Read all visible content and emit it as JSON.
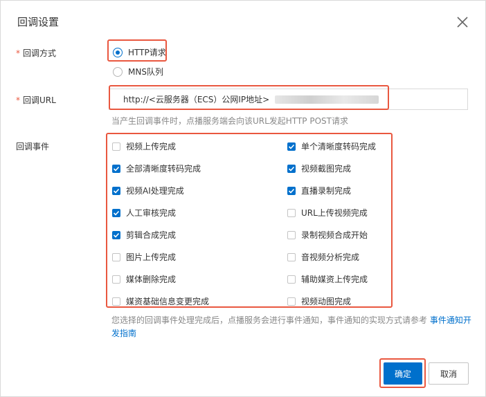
{
  "dialog": {
    "title": "回调设置"
  },
  "callback_method": {
    "label": "回调方式",
    "required_mark": "*",
    "options": [
      {
        "label": "HTTP请求",
        "selected": true
      },
      {
        "label": "MNS队列",
        "selected": false
      }
    ]
  },
  "callback_url": {
    "label": "回调URL",
    "required_mark": "*",
    "value": "http://<云服务器（ECS）公网IP地址>",
    "hint": "当产生回调事件时，点播服务端会向该URL发起HTTP POST请求"
  },
  "callback_events": {
    "label": "回调事件",
    "left": [
      {
        "label": "视频上传完成",
        "checked": false
      },
      {
        "label": "全部清晰度转码完成",
        "checked": true
      },
      {
        "label": "视频AI处理完成",
        "checked": true
      },
      {
        "label": "人工审核完成",
        "checked": true
      },
      {
        "label": "剪辑合成完成",
        "checked": true
      },
      {
        "label": "图片上传完成",
        "checked": false
      },
      {
        "label": "媒体删除完成",
        "checked": false
      },
      {
        "label": "媒资基础信息变更完成",
        "checked": false
      }
    ],
    "right": [
      {
        "label": "单个清晰度转码完成",
        "checked": true
      },
      {
        "label": "视频截图完成",
        "checked": true
      },
      {
        "label": "直播录制完成",
        "checked": true
      },
      {
        "label": "URL上传视频完成",
        "checked": false
      },
      {
        "label": "录制视频合成开始",
        "checked": false
      },
      {
        "label": "音视频分析完成",
        "checked": false
      },
      {
        "label": "辅助媒资上传完成",
        "checked": false
      },
      {
        "label": "视频动图完成",
        "checked": false
      }
    ]
  },
  "note": {
    "text": "您选择的回调事件处理完成后，点播服务会进行事件通知，事件通知的实现方式请参考 ",
    "link": "事件通知开发指南"
  },
  "footer": {
    "confirm_label": "确定",
    "cancel_label": "取消"
  },
  "colors": {
    "primary": "#0070cc",
    "highlight": "#e9573f"
  }
}
